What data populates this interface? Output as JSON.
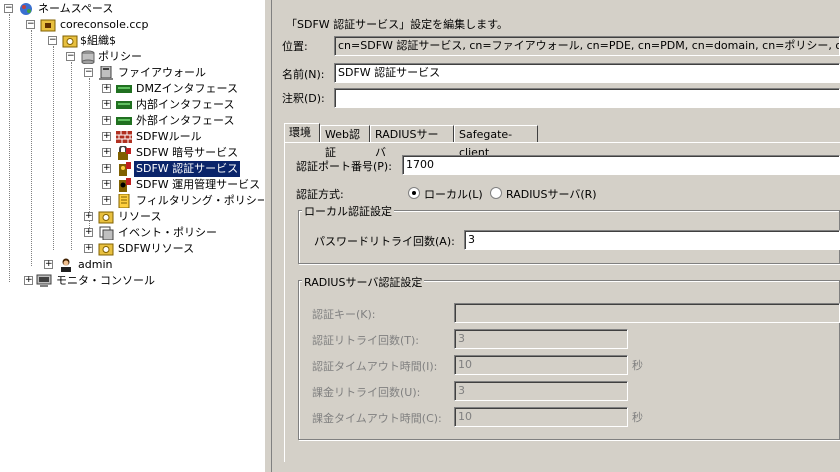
{
  "tree": {
    "root": "ネームスペース",
    "console": "coreconsole.ccp",
    "org": "$組織$",
    "policy": "ポリシー",
    "firewall": "ファイアウォール",
    "dmz": "DMZインタフェース",
    "inner": "内部インタフェース",
    "outer": "外部インタフェース",
    "sdfw_rule": "SDFWルール",
    "sdfw_crypto": "SDFW 暗号サービス",
    "sdfw_auth": "SDFW 認証サービス",
    "sdfw_admin": "SDFW 運用管理サービス",
    "filtering": "フィルタリング・ポリシー",
    "resource": "リソース",
    "event_policy": "イベント・ポリシー",
    "sdfw_resource": "SDFWリソース",
    "admin": "admin",
    "monitor": "モニタ・コンソール"
  },
  "panel": {
    "heading": "「SDFW 認証サービス」設定を編集します。",
    "location_label": "位置:",
    "location_value": "cn=SDFW 認証サービス, cn=ファイアウォール, cn=PDE, cn=PDM, cn=domain, cn=ポリシー, o=$組織$",
    "name_label": "名前(N):",
    "name_value": "SDFW 認証サービス",
    "note_label": "注釈(D):",
    "note_value": "",
    "tabs": [
      "環境",
      "Web認証",
      "RADIUSサーバ",
      "Safegate-client"
    ],
    "port_label": "認証ポート番号(P):",
    "port_value": "1700",
    "method_label": "認証方式:",
    "method_local": "ローカル(L)",
    "method_radius": "RADIUSサーバ(R)",
    "local_group": "ローカル認証設定",
    "pw_retry_label": "パスワードリトライ回数(A):",
    "pw_retry_value": "3",
    "radius_group": "RADIUSサーバ認証設定",
    "auth_key_label": "認証キー(K):",
    "auth_key_value": "",
    "auth_retry_label": "認証リトライ回数(T):",
    "auth_retry_value": "3",
    "auth_timeout_label": "認証タイムアウト時間(I):",
    "auth_timeout_value": "10",
    "bill_retry_label": "課金リトライ回数(U):",
    "bill_retry_value": "3",
    "bill_timeout_label": "課金タイムアウト時間(C):",
    "bill_timeout_value": "10",
    "sec_unit": "秒"
  }
}
